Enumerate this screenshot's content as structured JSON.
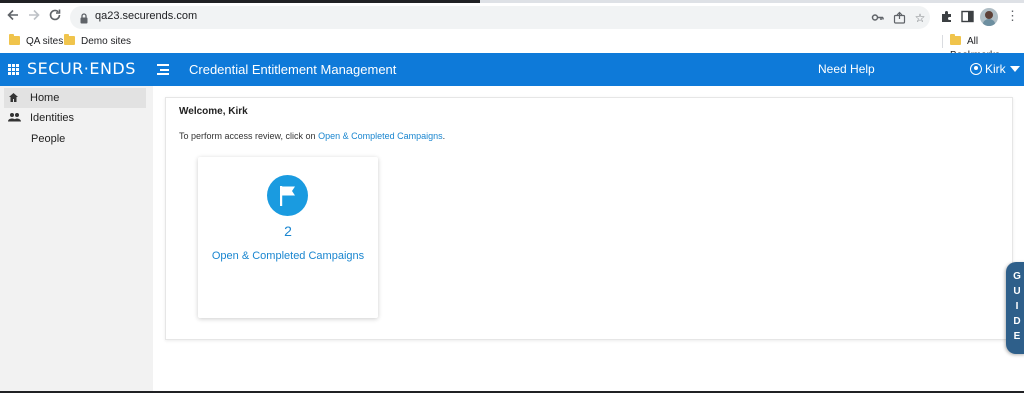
{
  "browser": {
    "url": "qa23.securends.com",
    "bookmarks": [
      {
        "label": "QA sites"
      },
      {
        "label": "Demo sites"
      }
    ],
    "all_bookmarks": "All Bookmarks"
  },
  "header": {
    "logo": "SECUR·ENDS",
    "title": "Credential Entitlement Management",
    "need_help": "Need Help",
    "user": "Kirk"
  },
  "sidebar": {
    "items": [
      {
        "label": "Home",
        "icon": "home-icon"
      },
      {
        "label": "Identities",
        "icon": "people-icon"
      },
      {
        "label": "People",
        "icon": ""
      }
    ]
  },
  "main": {
    "welcome": "Welcome, Kirk",
    "instruction_prefix": "To perform access review, click on ",
    "instruction_link": "Open & Completed Campaigns",
    "instruction_suffix": ".",
    "card": {
      "count": "2",
      "label": "Open & Completed Campaigns",
      "icon": "flag-icon"
    }
  },
  "guide": [
    "G",
    "U",
    "I",
    "D",
    "E"
  ],
  "colors": {
    "header_bg": "#0e7ad9",
    "accent": "#1a9be0",
    "link": "#1a86d0",
    "guide_tab": "#2e5f8a"
  }
}
